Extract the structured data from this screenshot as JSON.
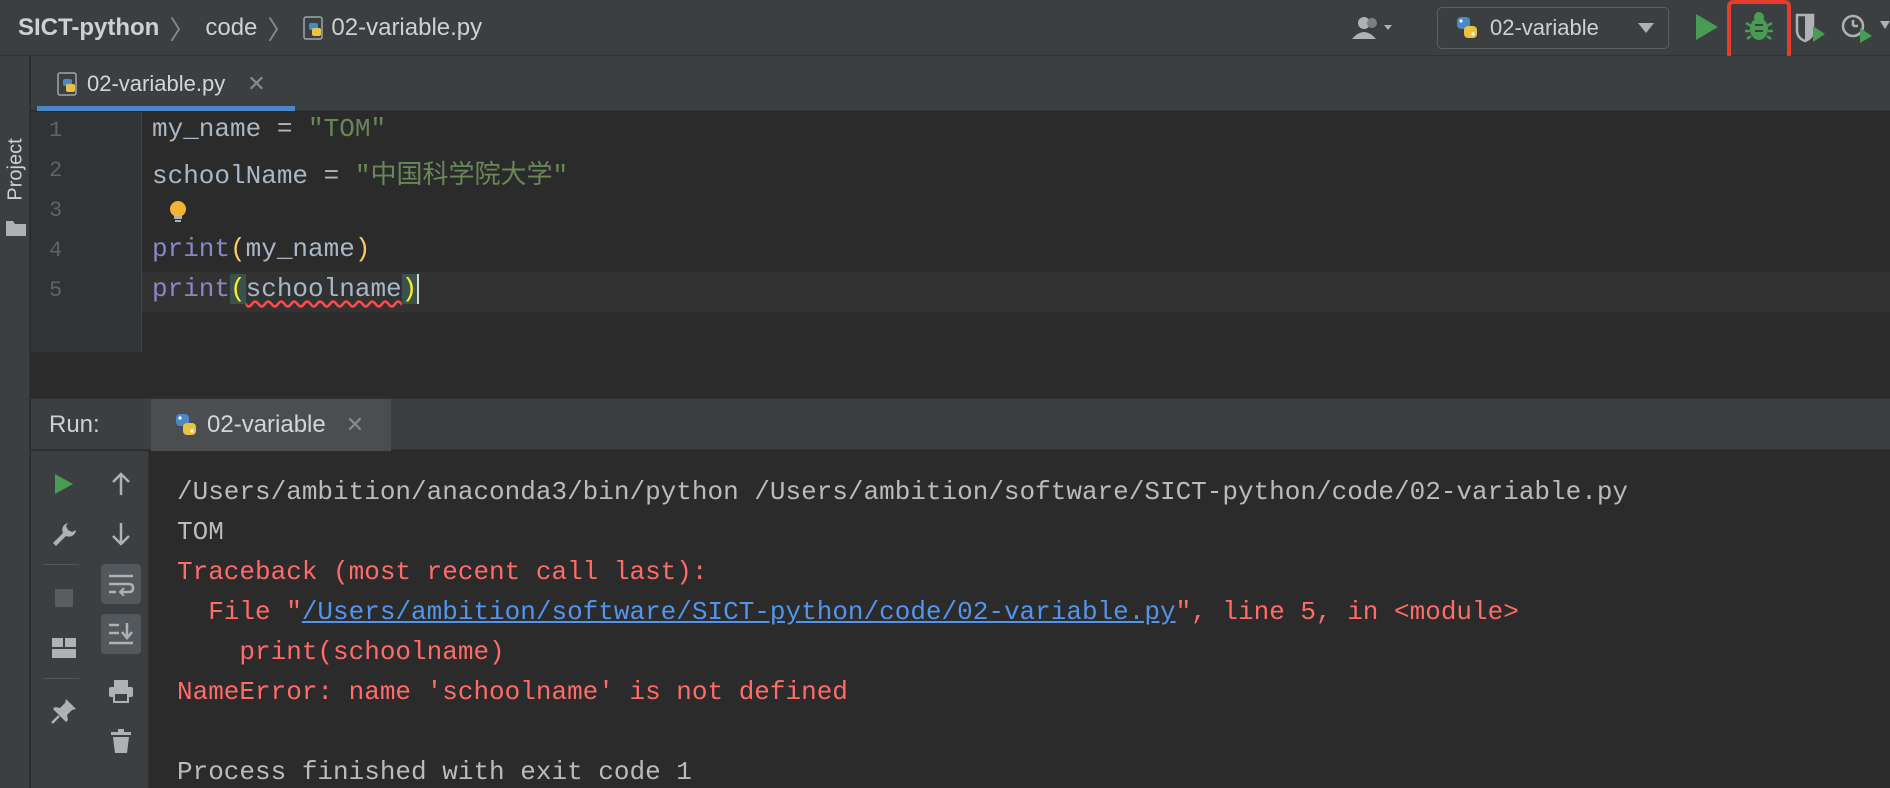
{
  "breadcrumb": {
    "project": "SICT-python",
    "folder": "code",
    "file": "02-variable.py"
  },
  "toolbar": {
    "run_config": "02-variable",
    "icons": [
      "user-icon",
      "run-icon",
      "debug-icon",
      "coverage-icon",
      "profile-icon"
    ]
  },
  "side_panel": {
    "project_label": "Project"
  },
  "editor": {
    "tab_label": "02-variable.py",
    "line_numbers": [
      "1",
      "2",
      "3",
      "4",
      "5"
    ],
    "lines": {
      "l1_var": "my_name",
      "l1_eq": " = ",
      "l1_str": "\"TOM\"",
      "l2_var": "schoolName",
      "l2_eq": " = ",
      "l2_str": "\"中国科学院大学\"",
      "l4_fn": "print",
      "l4_open": "(",
      "l4_arg": "my_name",
      "l4_close": ")",
      "l5_fn": "print",
      "l5_open": "(",
      "l5_arg": "schoolname",
      "l5_close": ")"
    }
  },
  "run_panel": {
    "label": "Run:",
    "tab_label": "02-variable",
    "console": {
      "cmd": "/Users/ambition/anaconda3/bin/python /Users/ambition/software/SICT-python/code/02-variable.py",
      "out1": "TOM",
      "traceback": "Traceback (most recent call last):",
      "file_prefix": "  File \"",
      "file_link": "/Users/ambition/software/SICT-python/code/02-variable.py",
      "file_suffix": "\", line 5, in <module>",
      "code_line": "    print(schoolname)",
      "error": "NameError: name 'schoolname' is not defined",
      "exit": "Process finished with exit code 1"
    }
  },
  "colors": {
    "accent_tab": "#4a88c7",
    "run_green": "#499c54",
    "error_red": "#ff6b68",
    "link_blue": "#5394ec",
    "highlight_box": "#e53c2c"
  }
}
